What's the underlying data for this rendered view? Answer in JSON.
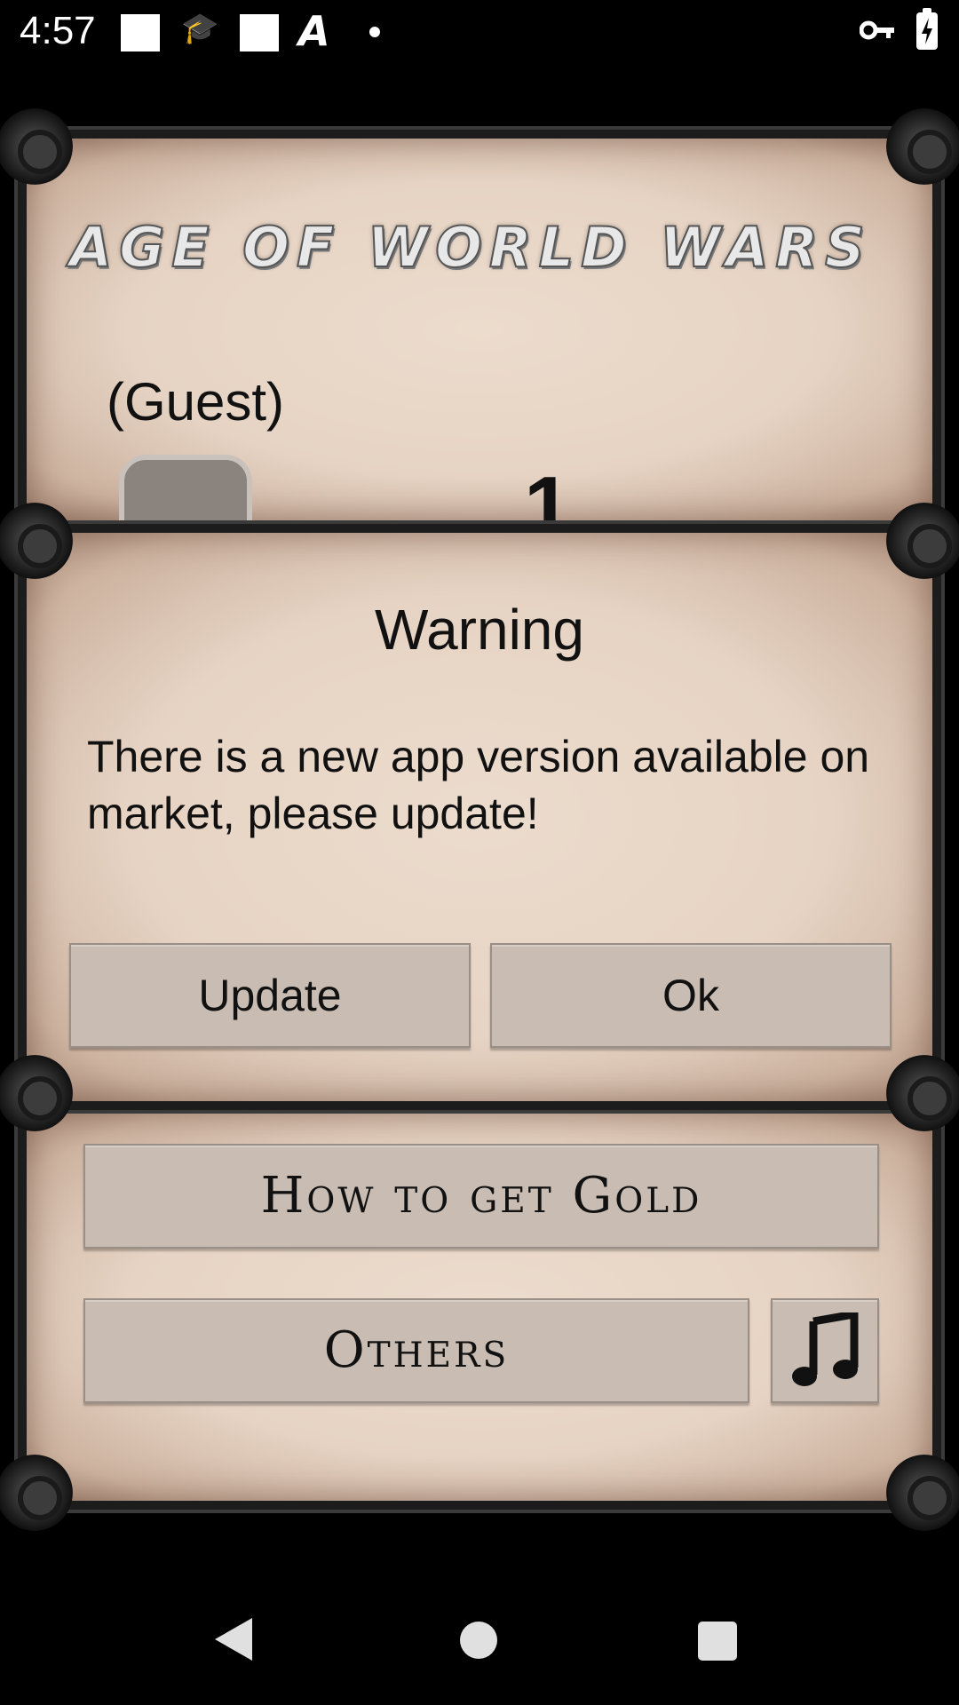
{
  "status_bar": {
    "time": "4:57",
    "icons": [
      "notification-square-icon",
      "graduation-cap-icon",
      "notification-square-icon",
      "a-letter-icon",
      "dot-icon",
      "vpn-key-icon",
      "battery-charging-icon"
    ],
    "a_glyph": "A",
    "cap_glyph": "🎓"
  },
  "game": {
    "title": "Age of World Wars",
    "player_name": "(Guest)",
    "level": "1"
  },
  "dialog": {
    "title": "Warning",
    "message": "There is a new app version available on market, please update!",
    "update_label": "Update",
    "ok_label": "Ok"
  },
  "menu": {
    "gold_label": "How to get Gold",
    "others_label": "Others",
    "music_icon": "music-note-icon"
  },
  "nav_bar": {
    "icons": [
      "back-icon",
      "home-icon",
      "recents-icon"
    ]
  }
}
